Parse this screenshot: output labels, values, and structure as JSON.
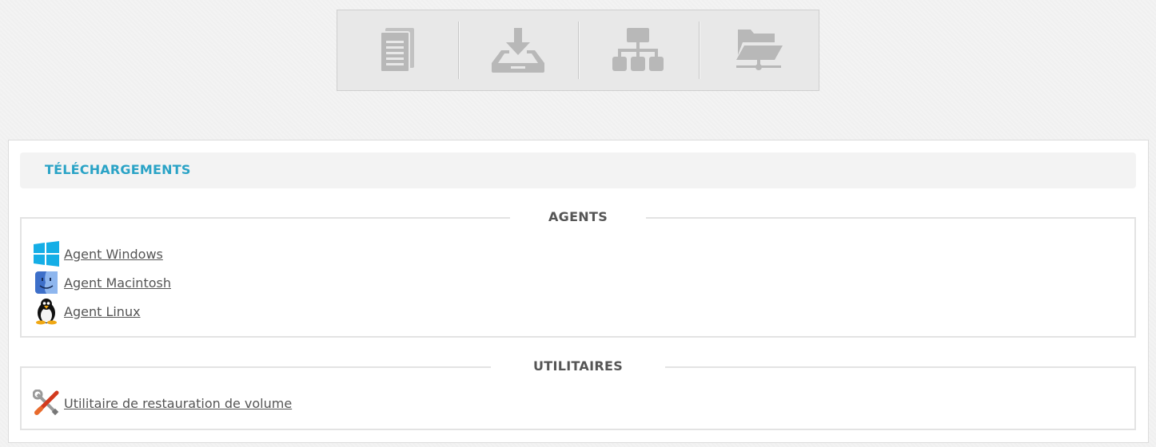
{
  "toolbar": {
    "buttons": [
      {
        "icon": "document-icon"
      },
      {
        "icon": "download-tray-icon"
      },
      {
        "icon": "sitemap-icon"
      },
      {
        "icon": "network-folder-icon"
      }
    ],
    "icon_color": "#b8b8b8"
  },
  "panel": {
    "title": "TÉLÉCHARGEMENTS",
    "title_color": "#2aa3c6"
  },
  "agents": {
    "legend": "AGENTS",
    "items": [
      {
        "label": "Agent Windows",
        "icon": "windows-icon"
      },
      {
        "label": "Agent Macintosh",
        "icon": "macintosh-finder-icon"
      },
      {
        "label": "Agent Linux",
        "icon": "linux-penguin-icon"
      }
    ]
  },
  "utilities": {
    "legend": "UTILITAIRES",
    "items": [
      {
        "label": "Utilitaire de restauration de volume",
        "icon": "tools-icon"
      }
    ]
  }
}
